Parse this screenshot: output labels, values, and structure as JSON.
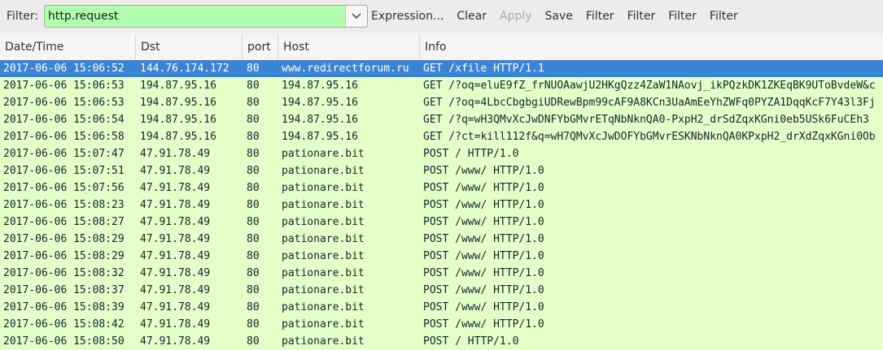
{
  "toolbar": {
    "filter_label": "Filter:",
    "filter_value": "http.request",
    "buttons": [
      "Expression...",
      "Clear",
      "Apply",
      "Save",
      "Filter",
      "Filter",
      "Filter",
      "Filter"
    ],
    "disabled_button": "Apply",
    "filter_bg_color": "#afffaf"
  },
  "columns": [
    "Date/Time",
    "Dst",
    "port",
    "Host",
    "Info"
  ],
  "colors": {
    "row_bg": "#e4ffc7",
    "selected_bg": "#3a84d5"
  },
  "rows": [
    {
      "datetime": "2017-06-06 15:06:52",
      "dst": "144.76.174.172",
      "port": "80",
      "host": "www.redirectforum.ru",
      "info": "GET /xfile HTTP/1.1",
      "selected": true
    },
    {
      "datetime": "2017-06-06 15:06:53",
      "dst": "194.87.95.16",
      "port": "80",
      "host": "194.87.95.16",
      "info": "GET /?oq=eluE9fZ_frNUOAawjU2HKgQzz4ZaW1NAovj_ikPQzkDK1ZKEqBK9UToBvdeW&c"
    },
    {
      "datetime": "2017-06-06 15:06:53",
      "dst": "194.87.95.16",
      "port": "80",
      "host": "194.87.95.16",
      "info": "GET /?oq=4LbcCbgbgiUDRewBpm99cAF9A8KCn3UaAmEeYhZWFq0PYZA1DqqKcF7Y43l3Fj"
    },
    {
      "datetime": "2017-06-06 15:06:54",
      "dst": "194.87.95.16",
      "port": "80",
      "host": "194.87.95.16",
      "info": "GET /?q=wH3QMvXcJwDNFYbGMvrETqNbNknQA0-PxpH2_drSdZqxKGni0eb5USk6FuCEh3"
    },
    {
      "datetime": "2017-06-06 15:06:58",
      "dst": "194.87.95.16",
      "port": "80",
      "host": "194.87.95.16",
      "info": "GET /?ct=kill112f&q=wH7QMvXcJwDOFYbGMvrESKNbNknQA0KPxpH2_drXdZqxKGni0Ob"
    },
    {
      "datetime": "2017-06-06 15:07:47",
      "dst": "47.91.78.49",
      "port": "80",
      "host": "pationare.bit",
      "info": "POST / HTTP/1.0"
    },
    {
      "datetime": "2017-06-06 15:07:51",
      "dst": "47.91.78.49",
      "port": "80",
      "host": "pationare.bit",
      "info": "POST /www/ HTTP/1.0"
    },
    {
      "datetime": "2017-06-06 15:07:56",
      "dst": "47.91.78.49",
      "port": "80",
      "host": "pationare.bit",
      "info": "POST /www/ HTTP/1.0"
    },
    {
      "datetime": "2017-06-06 15:08:23",
      "dst": "47.91.78.49",
      "port": "80",
      "host": "pationare.bit",
      "info": "POST /www/ HTTP/1.0"
    },
    {
      "datetime": "2017-06-06 15:08:27",
      "dst": "47.91.78.49",
      "port": "80",
      "host": "pationare.bit",
      "info": "POST /www/ HTTP/1.0"
    },
    {
      "datetime": "2017-06-06 15:08:29",
      "dst": "47.91.78.49",
      "port": "80",
      "host": "pationare.bit",
      "info": "POST /www/ HTTP/1.0"
    },
    {
      "datetime": "2017-06-06 15:08:29",
      "dst": "47.91.78.49",
      "port": "80",
      "host": "pationare.bit",
      "info": "POST /www/ HTTP/1.0"
    },
    {
      "datetime": "2017-06-06 15:08:32",
      "dst": "47.91.78.49",
      "port": "80",
      "host": "pationare.bit",
      "info": "POST /www/ HTTP/1.0"
    },
    {
      "datetime": "2017-06-06 15:08:37",
      "dst": "47.91.78.49",
      "port": "80",
      "host": "pationare.bit",
      "info": "POST /www/ HTTP/1.0"
    },
    {
      "datetime": "2017-06-06 15:08:39",
      "dst": "47.91.78.49",
      "port": "80",
      "host": "pationare.bit",
      "info": "POST /www/ HTTP/1.0"
    },
    {
      "datetime": "2017-06-06 15:08:42",
      "dst": "47.91.78.49",
      "port": "80",
      "host": "pationare.bit",
      "info": "POST /www/ HTTP/1.0"
    },
    {
      "datetime": "2017-06-06 15:08:50",
      "dst": "47.91.78.49",
      "port": "80",
      "host": "pationare.bit",
      "info": "POST / HTTP/1.0"
    }
  ]
}
